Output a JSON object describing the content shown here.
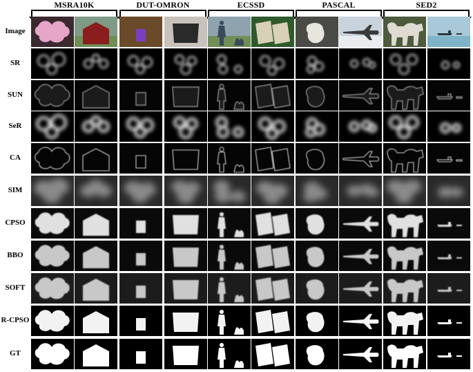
{
  "datasets": [
    {
      "id": "msra10k",
      "label": "MSRA10K"
    },
    {
      "id": "dut-omron",
      "label": "DUT-OMRON"
    },
    {
      "id": "ecssd",
      "label": "ECSSD"
    },
    {
      "id": "pascal",
      "label": "PASCAL"
    },
    {
      "id": "sed2",
      "label": "SED2"
    }
  ],
  "rows": [
    {
      "id": "image",
      "label": "Image"
    },
    {
      "id": "sr",
      "label": "SR"
    },
    {
      "id": "sun",
      "label": "SUN"
    },
    {
      "id": "ser",
      "label": "SeR"
    },
    {
      "id": "ca",
      "label": "CA"
    },
    {
      "id": "sim",
      "label": "SIM"
    },
    {
      "id": "cpso",
      "label": "CPSO"
    },
    {
      "id": "bbo",
      "label": "BBO"
    },
    {
      "id": "soft",
      "label": "SOFT"
    },
    {
      "id": "r-cpso",
      "label": "R-CPSO"
    },
    {
      "id": "gt",
      "label": "GT"
    }
  ],
  "columns": [
    {
      "id": "orchid"
    },
    {
      "id": "barn"
    },
    {
      "id": "interior"
    },
    {
      "id": "fireplace"
    },
    {
      "id": "person"
    },
    {
      "id": "book"
    },
    {
      "id": "lamb"
    },
    {
      "id": "airplane"
    },
    {
      "id": "horses"
    },
    {
      "id": "boat"
    }
  ]
}
